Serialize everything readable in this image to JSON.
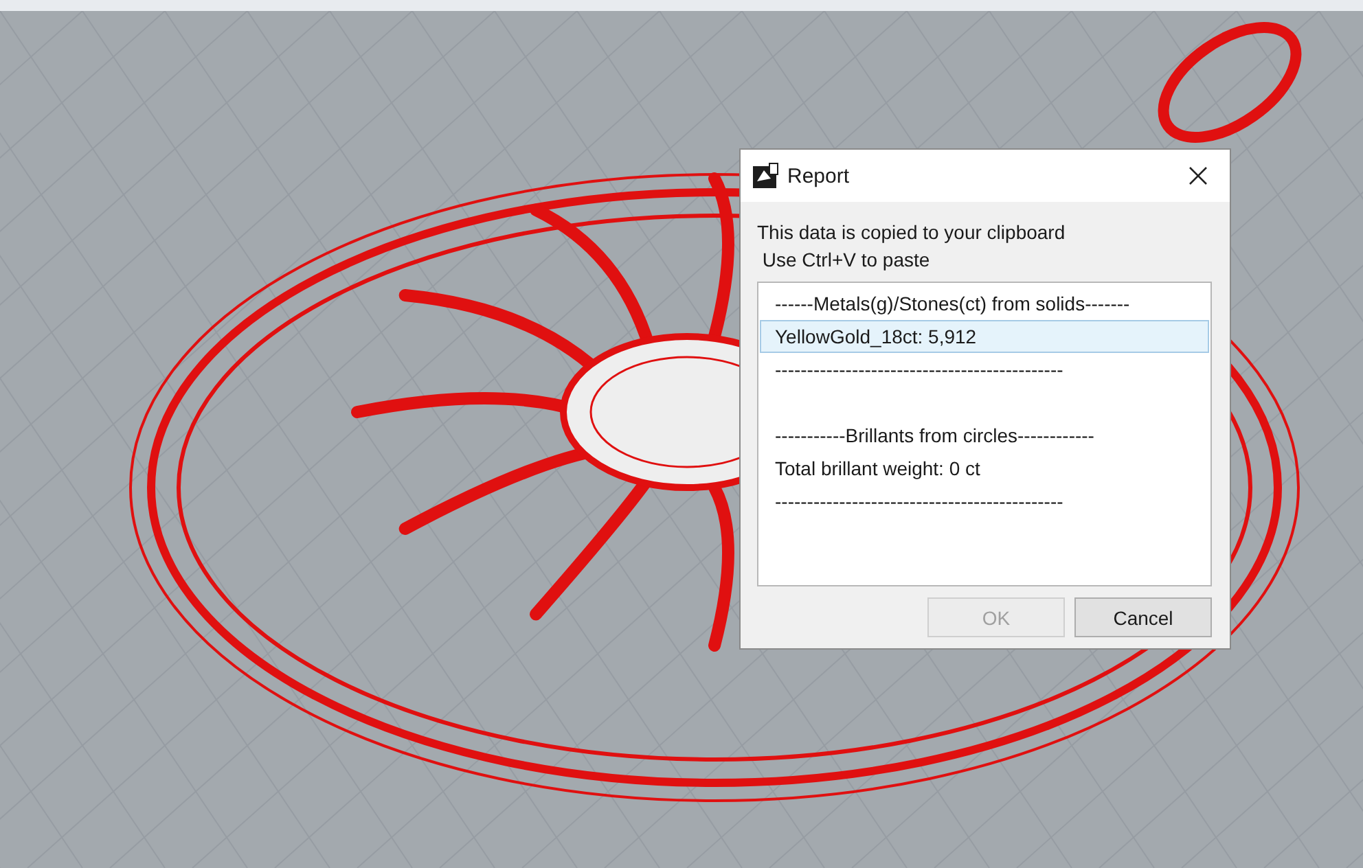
{
  "dialog": {
    "title": "Report",
    "message_lines": [
      "This data is copied to your clipboard",
      " Use Ctrl+V to paste"
    ],
    "list_items": [
      {
        "kind": "line",
        "text": "------Metals(g)/Stones(ct) from solids-------",
        "selected": false
      },
      {
        "kind": "line",
        "text": "YellowGold_18ct: 5,912",
        "selected": true
      },
      {
        "kind": "line",
        "text": "---------------------------------------------",
        "selected": false
      },
      {
        "kind": "blank"
      },
      {
        "kind": "line",
        "text": "-----------Brillants from circles------------",
        "selected": false
      },
      {
        "kind": "line",
        "text": "Total brillant weight: 0 ct",
        "selected": false
      },
      {
        "kind": "line",
        "text": "---------------------------------------------",
        "selected": false
      }
    ],
    "buttons": [
      {
        "label": "OK",
        "disabled": true
      },
      {
        "label": "Cancel",
        "disabled": false
      }
    ]
  }
}
